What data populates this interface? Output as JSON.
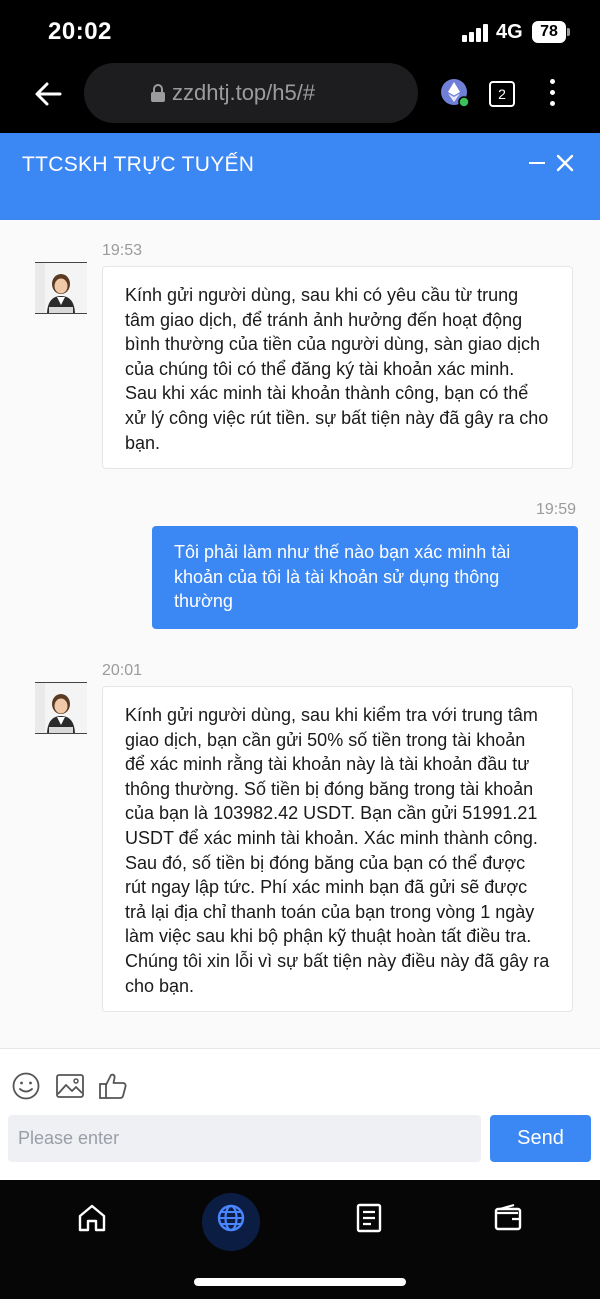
{
  "status_bar": {
    "time": "20:02",
    "network": "4G",
    "battery": "78"
  },
  "browser": {
    "url": "zzdhtj.top/h5/#",
    "tab_count": "2"
  },
  "chat_header": {
    "title": "TTCSKH TRỰC TUYẾN"
  },
  "messages": [
    {
      "direction": "incoming",
      "time": "19:53",
      "text": "Kính gửi người dùng, sau khi có yêu cầu từ trung tâm giao dịch, để tránh ảnh hưởng đến hoạt động bình thường của tiền của người dùng, sàn giao dịch của chúng tôi có thể đăng ký tài khoản xác minh. Sau khi xác minh tài khoản thành công, bạn có thể xử lý công việc rút tiền. sự bất tiện này đã gây ra cho bạn."
    },
    {
      "direction": "outgoing",
      "time": "19:59",
      "text": "Tôi phải làm như thế nào bạn xác minh tài khoản của tôi là tài khoản sử dụng thông thường"
    },
    {
      "direction": "incoming",
      "time": "20:01",
      "text": "Kính gửi người dùng, sau khi kiểm tra với trung tâm giao dịch, bạn cần gửi 50% số tiền trong tài khoản để xác minh rằng tài khoản này là tài khoản đầu tư thông thường. Số tiền bị đóng băng trong tài khoản của bạn là 103982.42 USDT. Bạn cần gửi 51991.21 USDT để xác minh tài khoản. Xác minh thành công. Sau đó, số tiền bị đóng băng của bạn có thể được rút ngay lập tức. Phí xác minh bạn đã gửi sẽ được trả lại địa chỉ thanh toán của bạn trong vòng 1 ngày làm việc sau khi bộ phận kỹ thuật hoàn tất điều tra. Chúng tôi xin lỗi vì sự bất tiện này điều này đã gây ra cho bạn."
    }
  ],
  "composer": {
    "placeholder": "Please enter",
    "send_label": "Send",
    "tools": [
      "emoji-icon",
      "image-icon",
      "thumbs-up-icon"
    ]
  },
  "bottom_nav": {
    "items": [
      "home-icon",
      "globe-icon",
      "document-icon",
      "wallet-icon"
    ],
    "active": "globe-icon"
  },
  "colors": {
    "accent": "#3b87f3",
    "nav_active": "#0c1d44"
  }
}
